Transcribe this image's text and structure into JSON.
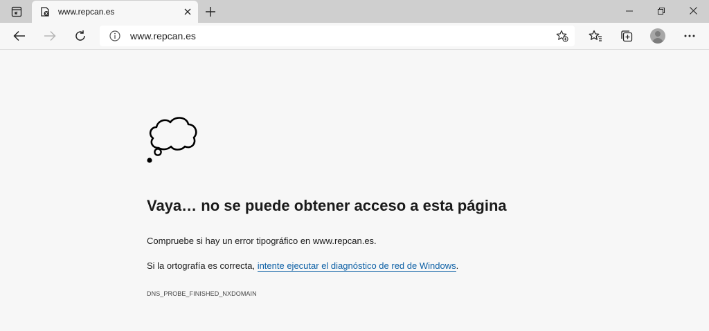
{
  "tab": {
    "title": "www.repcan.es"
  },
  "toolbar": {
    "url": "www.repcan.es"
  },
  "error_page": {
    "heading": "Vaya… no se puede obtener acceso a esta página",
    "line1": "Compruebe si hay un error tipográfico en www.repcan.es.",
    "line2_prefix": "Si la ortografía es correcta, ",
    "line2_link": "intente ejecutar el diagnóstico de red de Windows",
    "line2_suffix": ".",
    "error_code": "DNS_PROBE_FINISHED_NXDOMAIN"
  },
  "icons": {
    "tab_actions": "tab-actions-icon",
    "favicon": "broken-page-icon",
    "tab_close": "close-icon",
    "new_tab": "plus-icon",
    "minimize": "minimize-icon",
    "restore": "restore-icon",
    "close_window": "close-icon",
    "back": "back-arrow-icon",
    "forward": "forward-arrow-icon",
    "refresh": "refresh-icon",
    "site_info": "info-icon",
    "add_favorite": "star-plus-icon",
    "favorites": "favorites-icon",
    "collections": "collections-icon",
    "profile": "avatar-icon",
    "menu": "ellipsis-icon",
    "error_illustration": "thought-cloud-icon"
  },
  "colors": {
    "link": "#0b5fa5",
    "tabstrip": "#cfcfcf",
    "background": "#f7f7f7"
  }
}
